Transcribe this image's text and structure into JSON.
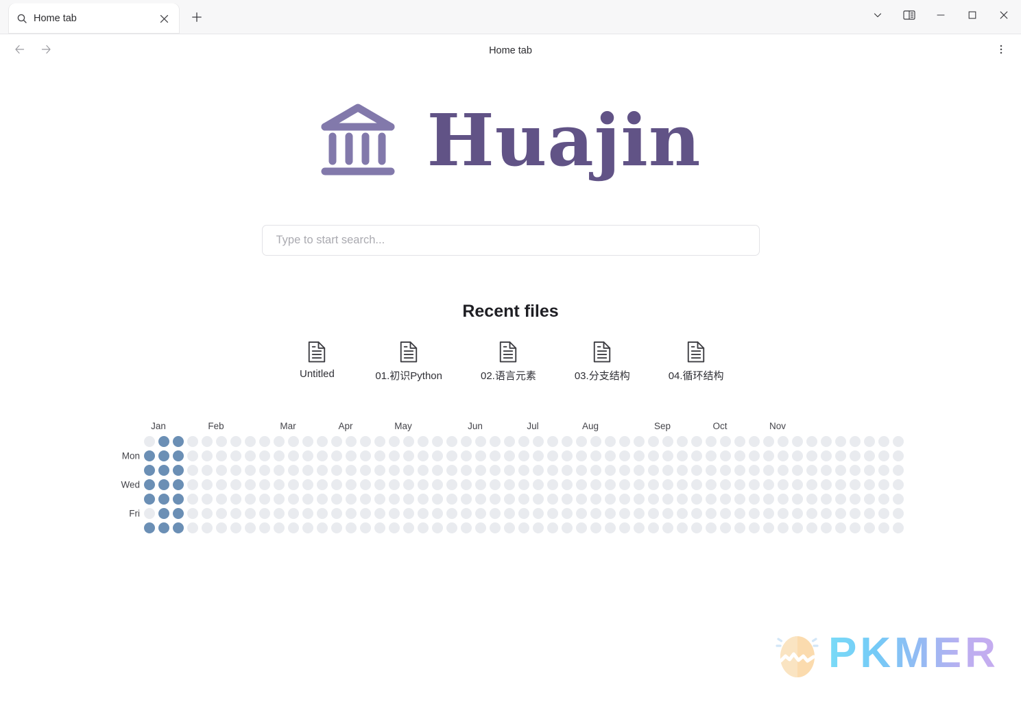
{
  "window": {
    "tab": {
      "title": "Home tab",
      "search_icon": "search-icon",
      "close_icon": "close-icon"
    },
    "new_tab_icon": "plus-icon",
    "controls": [
      {
        "name": "tab-list-dropdown",
        "icon": "chevron-down-icon"
      },
      {
        "name": "toggle-sidebar",
        "icon": "split-pane-icon"
      },
      {
        "name": "minimize",
        "icon": "minimize-icon"
      },
      {
        "name": "maximize",
        "icon": "maximize-icon"
      },
      {
        "name": "close",
        "icon": "close-icon"
      }
    ]
  },
  "navbar": {
    "back_icon": "arrow-left-icon",
    "forward_icon": "arrow-right-icon",
    "title": "Home tab",
    "more_icon": "more-vertical-icon"
  },
  "brand": {
    "logo_icon": "bank-pillars-icon",
    "name": "Huajin",
    "color": "#615386"
  },
  "search": {
    "placeholder": "Type to start search...",
    "value": ""
  },
  "recent": {
    "heading": "Recent files",
    "files": [
      {
        "label": "Untitled",
        "icon": "document-icon"
      },
      {
        "label": "01.初识Python",
        "icon": "document-icon"
      },
      {
        "label": "02.语言元素",
        "icon": "document-icon"
      },
      {
        "label": "03.分支结构",
        "icon": "document-icon"
      },
      {
        "label": "04.循环结构",
        "icon": "document-icon"
      }
    ]
  },
  "chart_data": {
    "type": "heatmap",
    "title": "",
    "months": [
      "Jan",
      "Feb",
      "Mar",
      "Apr",
      "May",
      "Jun",
      "Jul",
      "Aug",
      "Sep",
      "Oct",
      "Nov"
    ],
    "month_week_index": [
      0,
      4,
      9,
      13,
      17,
      22,
      26,
      30,
      35,
      39,
      43
    ],
    "day_labels": [
      "Mon",
      "Wed",
      "Fri"
    ],
    "day_row_index": [
      1,
      3,
      5
    ],
    "rows": 7,
    "columns": 53,
    "colors": {
      "empty": "#e9ebef",
      "filled": "#6b8fb5"
    },
    "legend": [],
    "active_cells": [
      [
        0,
        1
      ],
      [
        0,
        2
      ],
      [
        1,
        0
      ],
      [
        1,
        1
      ],
      [
        1,
        2
      ],
      [
        2,
        0
      ],
      [
        2,
        1
      ],
      [
        2,
        2
      ],
      [
        3,
        0
      ],
      [
        3,
        1
      ],
      [
        3,
        2
      ],
      [
        4,
        0
      ],
      [
        4,
        1
      ],
      [
        4,
        2
      ],
      [
        5,
        1
      ],
      [
        5,
        2
      ],
      [
        6,
        0
      ],
      [
        6,
        1
      ],
      [
        6,
        2
      ]
    ],
    "note": "active_cells are [row, column] pairs; all other cells are empty"
  },
  "watermark": {
    "text": "PKMER",
    "icon": "cracked-egg-icon"
  }
}
